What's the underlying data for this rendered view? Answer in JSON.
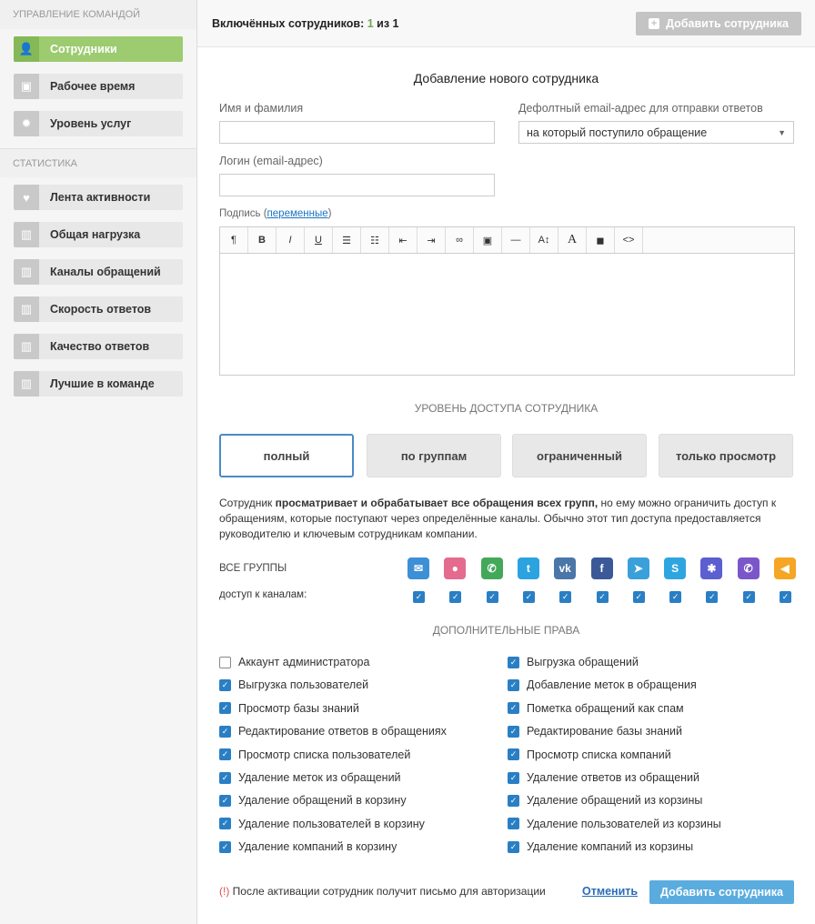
{
  "sidebar": {
    "section1": "Управление командой",
    "items1": [
      {
        "label": "Сотрудники",
        "icon": "person-icon"
      },
      {
        "label": "Рабочее время",
        "icon": "briefcase-icon"
      },
      {
        "label": "Уровень услуг",
        "icon": "gear-icon"
      }
    ],
    "section2": "Статистика",
    "items2": [
      {
        "label": "Лента активности",
        "icon": "heartbeat-icon"
      },
      {
        "label": "Общая нагрузка",
        "icon": "bar-chart-icon"
      },
      {
        "label": "Каналы обращений",
        "icon": "bar-chart-icon"
      },
      {
        "label": "Скорость ответов",
        "icon": "bar-chart-icon"
      },
      {
        "label": "Качество ответов",
        "icon": "bar-chart-icon"
      },
      {
        "label": "Лучшие в команде",
        "icon": "bar-chart-icon"
      }
    ]
  },
  "topbar": {
    "count_prefix": "Включённых сотрудников:",
    "count_value": "1",
    "count_suffix": "из 1",
    "add_button": "Добавить сотрудника"
  },
  "form": {
    "title": "Добавление нового сотрудника",
    "name_label": "Имя и фамилия",
    "name_value": "",
    "email_label": "Дефолтный email-адрес для отправки ответов",
    "email_select": "на который поступило обращение",
    "login_label": "Логин (email-адрес)",
    "login_value": "",
    "signature_label": "Подпись (",
    "signature_link": "переменные",
    "signature_close": ")",
    "toolbar": [
      "¶",
      "B",
      "I",
      "U",
      "☰",
      "☷",
      "⇤",
      "⇥",
      "∞",
      "▣",
      "—",
      "A↕",
      "A",
      "◼",
      "<>"
    ]
  },
  "access": {
    "title": "Уровень доступа сотрудника",
    "levels": [
      "полный",
      "по группам",
      "ограниченный",
      "только просмотр"
    ],
    "selected": 0,
    "desc_1": "Сотрудник ",
    "desc_bold": "просматривает и обрабатывает все обращения всех групп,",
    "desc_2": " но ему можно ограничить доступ к обращениям, которые поступают через определённые каналы. Обычно этот тип доступа предоставляется руководителю и ключевым сотрудникам компании.",
    "groups_label": "ВСЕ ГРУППЫ",
    "channels_label": "доступ к каналам:",
    "channels": [
      {
        "icon": "email-icon",
        "glyph": "✉",
        "color": "#3d8fd6"
      },
      {
        "icon": "chat-icon",
        "glyph": "●",
        "color": "#e46a8e"
      },
      {
        "icon": "phone-icon",
        "glyph": "✆",
        "color": "#44a85a"
      },
      {
        "icon": "twitter-icon",
        "glyph": "t",
        "color": "#2aa3e0"
      },
      {
        "icon": "vk-icon",
        "glyph": "vk",
        "color": "#4a76a8"
      },
      {
        "icon": "facebook-icon",
        "glyph": "f",
        "color": "#3b5998"
      },
      {
        "icon": "telegram-icon",
        "glyph": "➤",
        "color": "#3aa0da"
      },
      {
        "icon": "skype-icon",
        "glyph": "S",
        "color": "#2fa5e0"
      },
      {
        "icon": "widget-icon",
        "glyph": "✱",
        "color": "#5b5fcf"
      },
      {
        "icon": "viber-icon",
        "glyph": "✆",
        "color": "#7b56c9"
      },
      {
        "icon": "megaphone-icon",
        "glyph": "◀",
        "color": "#f5a623"
      }
    ]
  },
  "permissions": {
    "title": "Дополнительные права",
    "left": [
      {
        "label": "Аккаунт администратора",
        "checked": false
      },
      {
        "label": "Выгрузка пользователей",
        "checked": true
      },
      {
        "label": "Просмотр базы знаний",
        "checked": true
      },
      {
        "label": "Редактирование ответов в обращениях",
        "checked": true
      },
      {
        "label": "Просмотр списка пользователей",
        "checked": true
      },
      {
        "label": "Удаление меток из обращений",
        "checked": true
      },
      {
        "label": "Удаление обращений в корзину",
        "checked": true
      },
      {
        "label": "Удаление пользователей в корзину",
        "checked": true
      },
      {
        "label": "Удаление компаний в корзину",
        "checked": true
      }
    ],
    "right": [
      {
        "label": "Выгрузка обращений",
        "checked": true
      },
      {
        "label": "Добавление меток в обращения",
        "checked": true
      },
      {
        "label": "Пометка обращений как спам",
        "checked": true
      },
      {
        "label": "Редактирование базы знаний",
        "checked": true
      },
      {
        "label": "Просмотр списка компаний",
        "checked": true
      },
      {
        "label": "Удаление ответов из обращений",
        "checked": true
      },
      {
        "label": "Удаление обращений из корзины",
        "checked": true
      },
      {
        "label": "Удаление пользователей из корзины",
        "checked": true
      },
      {
        "label": "Удаление компаний из корзины",
        "checked": true
      }
    ]
  },
  "footer": {
    "note_mark": "(!)",
    "note": " После активации сотрудник получит письмо для авторизации",
    "cancel": "Отменить",
    "submit": "Добавить сотрудника"
  }
}
